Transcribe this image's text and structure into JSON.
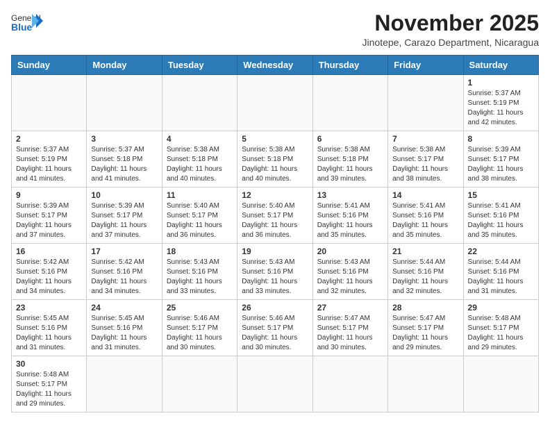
{
  "header": {
    "logo_general": "General",
    "logo_blue": "Blue",
    "month_title": "November 2025",
    "location": "Jinotepe, Carazo Department, Nicaragua"
  },
  "days_of_week": [
    "Sunday",
    "Monday",
    "Tuesday",
    "Wednesday",
    "Thursday",
    "Friday",
    "Saturday"
  ],
  "weeks": [
    [
      {
        "day": "",
        "info": ""
      },
      {
        "day": "",
        "info": ""
      },
      {
        "day": "",
        "info": ""
      },
      {
        "day": "",
        "info": ""
      },
      {
        "day": "",
        "info": ""
      },
      {
        "day": "",
        "info": ""
      },
      {
        "day": "1",
        "info": "Sunrise: 5:37 AM\nSunset: 5:19 PM\nDaylight: 11 hours\nand 42 minutes."
      }
    ],
    [
      {
        "day": "2",
        "info": "Sunrise: 5:37 AM\nSunset: 5:19 PM\nDaylight: 11 hours\nand 41 minutes."
      },
      {
        "day": "3",
        "info": "Sunrise: 5:37 AM\nSunset: 5:18 PM\nDaylight: 11 hours\nand 41 minutes."
      },
      {
        "day": "4",
        "info": "Sunrise: 5:38 AM\nSunset: 5:18 PM\nDaylight: 11 hours\nand 40 minutes."
      },
      {
        "day": "5",
        "info": "Sunrise: 5:38 AM\nSunset: 5:18 PM\nDaylight: 11 hours\nand 40 minutes."
      },
      {
        "day": "6",
        "info": "Sunrise: 5:38 AM\nSunset: 5:18 PM\nDaylight: 11 hours\nand 39 minutes."
      },
      {
        "day": "7",
        "info": "Sunrise: 5:38 AM\nSunset: 5:17 PM\nDaylight: 11 hours\nand 38 minutes."
      },
      {
        "day": "8",
        "info": "Sunrise: 5:39 AM\nSunset: 5:17 PM\nDaylight: 11 hours\nand 38 minutes."
      }
    ],
    [
      {
        "day": "9",
        "info": "Sunrise: 5:39 AM\nSunset: 5:17 PM\nDaylight: 11 hours\nand 37 minutes."
      },
      {
        "day": "10",
        "info": "Sunrise: 5:39 AM\nSunset: 5:17 PM\nDaylight: 11 hours\nand 37 minutes."
      },
      {
        "day": "11",
        "info": "Sunrise: 5:40 AM\nSunset: 5:17 PM\nDaylight: 11 hours\nand 36 minutes."
      },
      {
        "day": "12",
        "info": "Sunrise: 5:40 AM\nSunset: 5:17 PM\nDaylight: 11 hours\nand 36 minutes."
      },
      {
        "day": "13",
        "info": "Sunrise: 5:41 AM\nSunset: 5:16 PM\nDaylight: 11 hours\nand 35 minutes."
      },
      {
        "day": "14",
        "info": "Sunrise: 5:41 AM\nSunset: 5:16 PM\nDaylight: 11 hours\nand 35 minutes."
      },
      {
        "day": "15",
        "info": "Sunrise: 5:41 AM\nSunset: 5:16 PM\nDaylight: 11 hours\nand 35 minutes."
      }
    ],
    [
      {
        "day": "16",
        "info": "Sunrise: 5:42 AM\nSunset: 5:16 PM\nDaylight: 11 hours\nand 34 minutes."
      },
      {
        "day": "17",
        "info": "Sunrise: 5:42 AM\nSunset: 5:16 PM\nDaylight: 11 hours\nand 34 minutes."
      },
      {
        "day": "18",
        "info": "Sunrise: 5:43 AM\nSunset: 5:16 PM\nDaylight: 11 hours\nand 33 minutes."
      },
      {
        "day": "19",
        "info": "Sunrise: 5:43 AM\nSunset: 5:16 PM\nDaylight: 11 hours\nand 33 minutes."
      },
      {
        "day": "20",
        "info": "Sunrise: 5:43 AM\nSunset: 5:16 PM\nDaylight: 11 hours\nand 32 minutes."
      },
      {
        "day": "21",
        "info": "Sunrise: 5:44 AM\nSunset: 5:16 PM\nDaylight: 11 hours\nand 32 minutes."
      },
      {
        "day": "22",
        "info": "Sunrise: 5:44 AM\nSunset: 5:16 PM\nDaylight: 11 hours\nand 31 minutes."
      }
    ],
    [
      {
        "day": "23",
        "info": "Sunrise: 5:45 AM\nSunset: 5:16 PM\nDaylight: 11 hours\nand 31 minutes."
      },
      {
        "day": "24",
        "info": "Sunrise: 5:45 AM\nSunset: 5:16 PM\nDaylight: 11 hours\nand 31 minutes."
      },
      {
        "day": "25",
        "info": "Sunrise: 5:46 AM\nSunset: 5:17 PM\nDaylight: 11 hours\nand 30 minutes."
      },
      {
        "day": "26",
        "info": "Sunrise: 5:46 AM\nSunset: 5:17 PM\nDaylight: 11 hours\nand 30 minutes."
      },
      {
        "day": "27",
        "info": "Sunrise: 5:47 AM\nSunset: 5:17 PM\nDaylight: 11 hours\nand 30 minutes."
      },
      {
        "day": "28",
        "info": "Sunrise: 5:47 AM\nSunset: 5:17 PM\nDaylight: 11 hours\nand 29 minutes."
      },
      {
        "day": "29",
        "info": "Sunrise: 5:48 AM\nSunset: 5:17 PM\nDaylight: 11 hours\nand 29 minutes."
      }
    ],
    [
      {
        "day": "30",
        "info": "Sunrise: 5:48 AM\nSunset: 5:17 PM\nDaylight: 11 hours\nand 29 minutes."
      },
      {
        "day": "",
        "info": ""
      },
      {
        "day": "",
        "info": ""
      },
      {
        "day": "",
        "info": ""
      },
      {
        "day": "",
        "info": ""
      },
      {
        "day": "",
        "info": ""
      },
      {
        "day": "",
        "info": ""
      }
    ]
  ]
}
